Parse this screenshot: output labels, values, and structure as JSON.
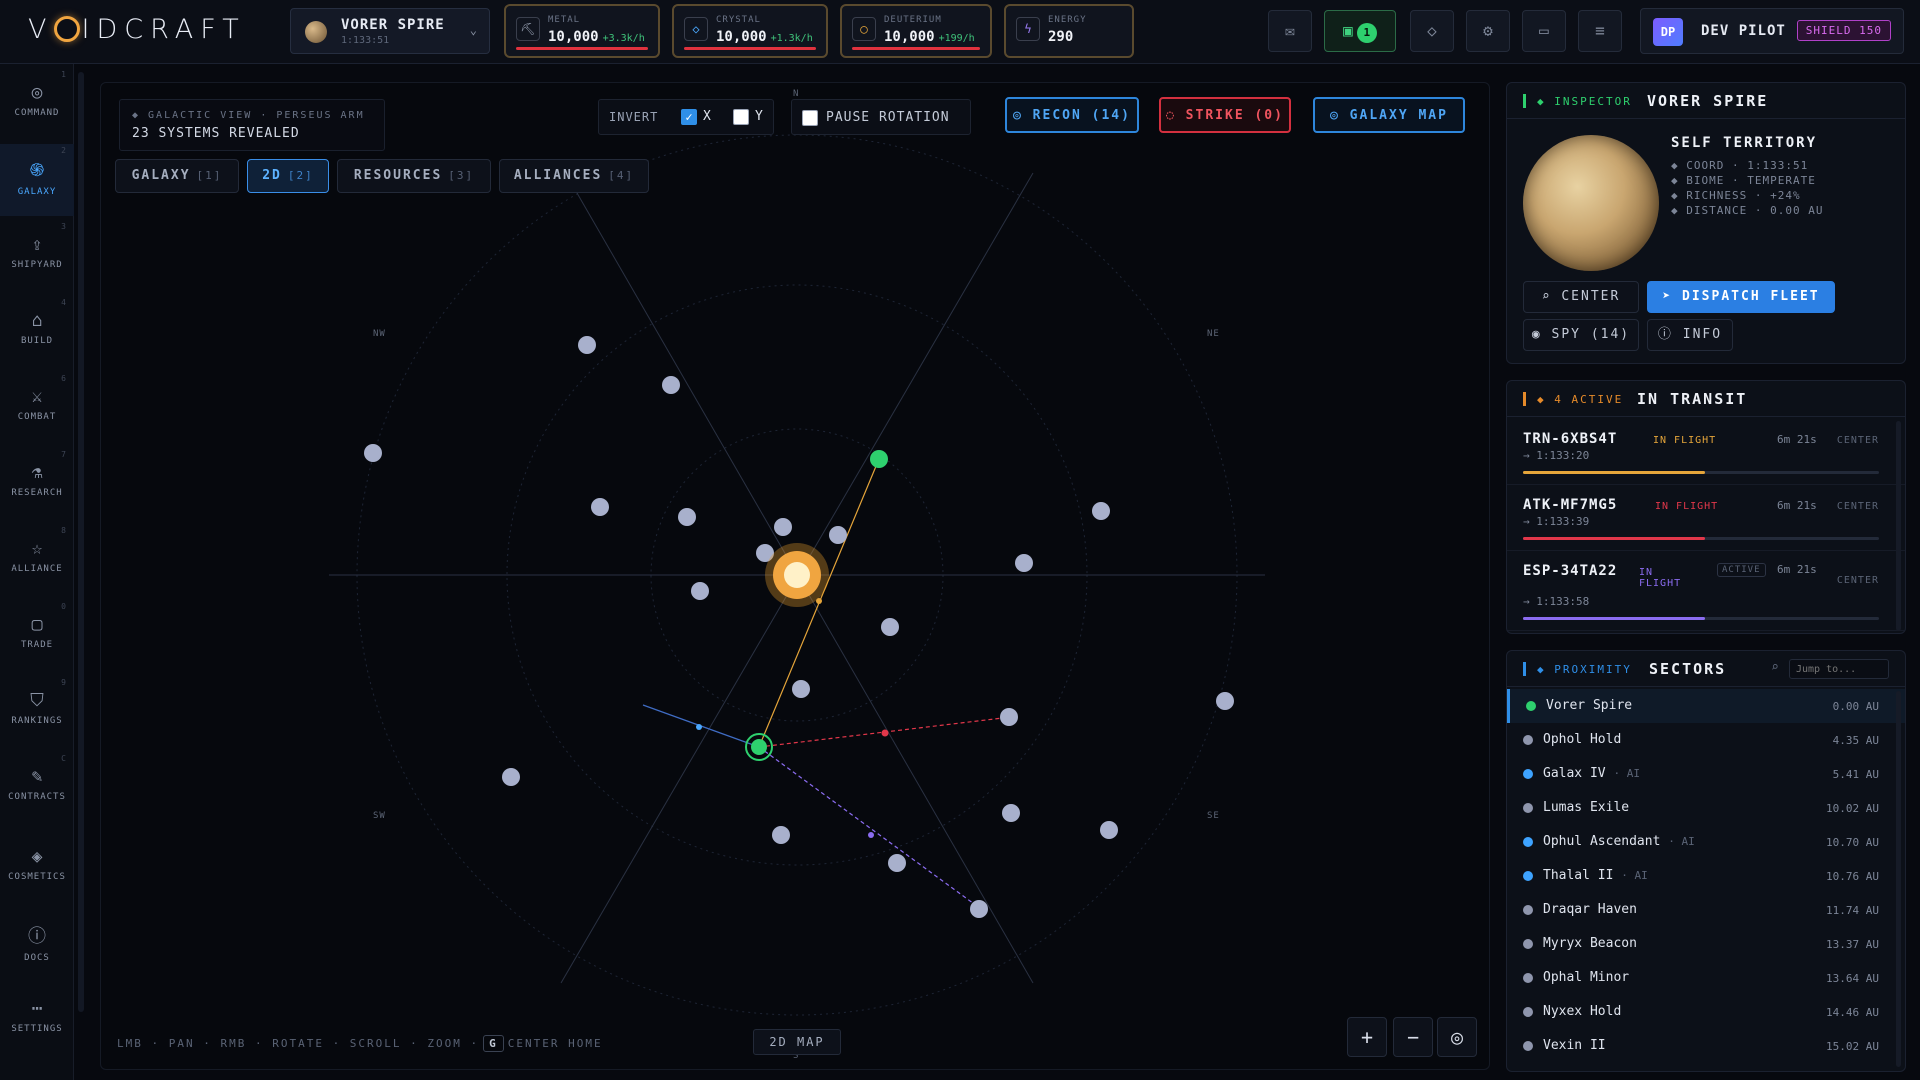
{
  "app": {
    "logo": "VOIDCRAFT"
  },
  "planet_selector": {
    "name": "VORER SPIRE",
    "coord": "1:133:51"
  },
  "resources": [
    {
      "label": "METAL",
      "value": "10,000",
      "rate": "+3.3k/h",
      "icon": "pickaxe-icon"
    },
    {
      "label": "CRYSTAL",
      "value": "10,000",
      "rate": "+1.3k/h",
      "icon": "gem-icon"
    },
    {
      "label": "DEUTERIUM",
      "value": "10,000",
      "rate": "+199/h",
      "icon": "flask-icon"
    },
    {
      "label": "ENERGY",
      "value": "290",
      "rate": "",
      "icon": "bolt-icon"
    }
  ],
  "topbar": {
    "notification_count": "1",
    "user": {
      "initials": "DP",
      "name": "DEV PILOT",
      "shield": "SHIELD 150"
    }
  },
  "sidebar": [
    {
      "num": "1",
      "label": "COMMAND",
      "icon": "target-icon"
    },
    {
      "num": "2",
      "label": "GALAXY",
      "icon": "galaxy-icon"
    },
    {
      "num": "3",
      "label": "SHIPYARD",
      "icon": "rocket-icon"
    },
    {
      "num": "4",
      "label": "BUILD",
      "icon": "factory-icon"
    },
    {
      "num": "6",
      "label": "COMBAT",
      "icon": "sword-icon"
    },
    {
      "num": "7",
      "label": "RESEARCH",
      "icon": "flask-icon"
    },
    {
      "num": "8",
      "label": "ALLIANCE",
      "icon": "star-icon"
    },
    {
      "num": "0",
      "label": "TRADE",
      "icon": "briefcase-icon"
    },
    {
      "num": "9",
      "label": "RANKINGS",
      "icon": "shield-icon"
    },
    {
      "num": "C",
      "label": "CONTRACTS",
      "icon": "pen-icon"
    },
    {
      "num": "",
      "label": "COSMETICS",
      "icon": "diamond-icon"
    },
    {
      "num": "",
      "label": "DOCS",
      "icon": "info-icon"
    },
    {
      "num": "",
      "label": "SETTINGS",
      "icon": "dots-icon"
    }
  ],
  "map": {
    "header_line1": "◆ GALACTIC VIEW · PERSEUS ARM",
    "header_line2": "23 SYSTEMS REVEALED",
    "tabs": [
      {
        "label": "GALAXY",
        "count": "[1]"
      },
      {
        "label": "2D",
        "count": "[2]"
      },
      {
        "label": "RESOURCES",
        "count": "[3]"
      },
      {
        "label": "ALLIANCES",
        "count": "[4]"
      }
    ],
    "invert_label": "INVERT",
    "invert_x_label": "X",
    "invert_y_label": "Y",
    "invert_x": true,
    "invert_y": false,
    "pause_rotation_label": "PAUSE ROTATION",
    "recon_label": "◎ RECON (14)",
    "strike_label": "◌ STRIKE (0)",
    "galaxy_map_label": "◎ GALAXY MAP",
    "compass": {
      "n": "N",
      "s": "S",
      "nw": "NW",
      "ne": "NE",
      "sw": "SW",
      "se": "SE"
    },
    "help_text_a": "LMB · PAN · RMB · ROTATE · SCROLL · ZOOM ·",
    "help_key": "G",
    "help_text_b": "CENTER HOME",
    "mode_label": "2D MAP",
    "zoom_in": "+",
    "zoom_out": "−",
    "recenter_icon": "target-icon"
  },
  "inspector": {
    "kicker": "◆ INSPECTOR",
    "title": "VORER SPIRE",
    "territory": "SELF TERRITORY",
    "coord": "◆ COORD · 1:133:51",
    "biome": "◆ BIOME · TEMPERATE",
    "richness": "◆ RICHNESS · +24%",
    "distance": "◆ DISTANCE · 0.00 AU",
    "center_label": "⌕ CENTER",
    "dispatch_label": "➤ DISPATCH FLEET",
    "spy_label": "◉ SPY (14)",
    "info_label": "ⓘ INFO"
  },
  "transit": {
    "kicker": "◆ 4 ACTIVE",
    "title": "IN TRANSIT",
    "fleets": [
      {
        "id": "TRN-6XBS4T",
        "status": "IN FLIGHT",
        "time": "6m 21s",
        "dest": "→ 1:133:20",
        "progress": 0.51,
        "color": "#e5a53a",
        "center": "CENTER"
      },
      {
        "id": "ATK-MF7MG5",
        "status": "IN FLIGHT",
        "time": "6m 21s",
        "dest": "→ 1:133:39",
        "progress": 0.51,
        "color": "#e2374a",
        "center": "CENTER"
      },
      {
        "id": "ESP-34TA22",
        "status": "IN FLIGHT",
        "badge": "ACTIVE",
        "time": "6m 21s",
        "dest": "→ 1:133:58",
        "progress": 0.51,
        "color": "#8b6cf0",
        "center": "CENTER"
      }
    ]
  },
  "proximity": {
    "kicker": "◆ PROXIMITY",
    "title": "SECTORS",
    "search_placeholder": "Jump to...",
    "sectors": [
      {
        "name": "Vorer Spire",
        "ai": "",
        "dist": "0.00 AU",
        "color": "#2ed06e"
      },
      {
        "name": "Ophol Hold",
        "ai": "",
        "dist": "4.35 AU",
        "color": "#8f96ad"
      },
      {
        "name": "Galax IV",
        "ai": "· AI",
        "dist": "5.41 AU",
        "color": "#3ea3ff"
      },
      {
        "name": "Lumas Exile",
        "ai": "",
        "dist": "10.02 AU",
        "color": "#8f96ad"
      },
      {
        "name": "Ophul Ascendant",
        "ai": "· AI",
        "dist": "10.70 AU",
        "color": "#3ea3ff"
      },
      {
        "name": "Thalal II",
        "ai": "· AI",
        "dist": "10.76 AU",
        "color": "#3ea3ff"
      },
      {
        "name": "Draqar Haven",
        "ai": "",
        "dist": "11.74 AU",
        "color": "#8f96ad"
      },
      {
        "name": "Myryx Beacon",
        "ai": "",
        "dist": "13.37 AU",
        "color": "#8f96ad"
      },
      {
        "name": "Ophal Minor",
        "ai": "",
        "dist": "13.64 AU",
        "color": "#8f96ad"
      },
      {
        "name": "Nyxex Hold",
        "ai": "",
        "dist": "14.46 AU",
        "color": "#8f96ad"
      },
      {
        "name": "Vexin II",
        "ai": "",
        "dist": "15.02 AU",
        "color": "#8f96ad"
      }
    ]
  }
}
